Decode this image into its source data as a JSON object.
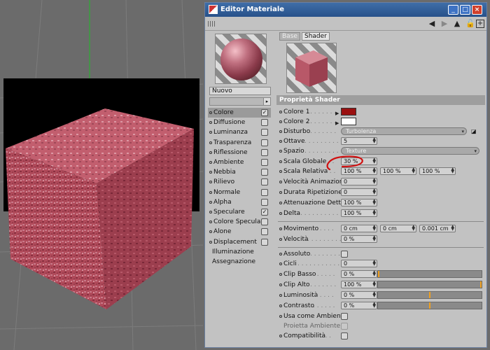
{
  "window": {
    "title": "Editor Materiale",
    "toolbar_icons": [
      "back-arrow-icon",
      "forward-arrow-icon",
      "up-arrow-icon",
      "lock-icon",
      "plus-icon"
    ]
  },
  "material": {
    "name": "Nuovo",
    "channels": [
      {
        "label": "Colore",
        "checked": true,
        "selected": true
      },
      {
        "label": "Diffusione",
        "checked": false
      },
      {
        "label": "Luminanza",
        "checked": false
      },
      {
        "label": "Trasparenza",
        "checked": false
      },
      {
        "label": "Riflessione",
        "checked": false
      },
      {
        "label": "Ambiente",
        "checked": false
      },
      {
        "label": "Nebbia",
        "checked": false
      },
      {
        "label": "Rilievo",
        "checked": false
      },
      {
        "label": "Normale",
        "checked": false
      },
      {
        "label": "Alpha",
        "checked": false
      },
      {
        "label": "Speculare",
        "checked": true
      },
      {
        "label": "Colore Speculare",
        "checked": false
      },
      {
        "label": "Alone",
        "checked": false
      },
      {
        "label": "Displacement",
        "checked": false
      }
    ],
    "extra_items": [
      "Illuminazione",
      "Assegnazione"
    ]
  },
  "tabs": [
    "Base",
    "Shader"
  ],
  "shader": {
    "section_title": "Proprietà Shader",
    "colore1": {
      "label": "Colore 1",
      "color": "#9a1010"
    },
    "colore2": {
      "label": "Colore 2",
      "color": "#ffffff"
    },
    "disturbo": {
      "label": "Disturbo",
      "value": "Turbolenza"
    },
    "ottave": {
      "label": "Ottave",
      "value": "5"
    },
    "spazio": {
      "label": "Spazio",
      "value": "Texture"
    },
    "scala_globale": {
      "label": "Scala Globale",
      "value": "30 %"
    },
    "scala_relativa": {
      "label": "Scala Relativa",
      "values": [
        "100 %",
        "100 %",
        "100 %"
      ]
    },
    "velocita_animazione": {
      "label": "Velocità Animazione",
      "value": "0"
    },
    "durata_ripetizione": {
      "label": "Durata Ripetizione",
      "value": "0"
    },
    "attenuazione_dettagli": {
      "label": "Attenuazione Dettagli",
      "value": "100 %"
    },
    "delta": {
      "label": "Delta",
      "value": "100 %"
    },
    "movimento": {
      "label": "Movimento",
      "values": [
        "0 cm",
        "0 cm",
        "0.001 cm"
      ]
    },
    "velocita": {
      "label": "Velocità",
      "value": "0 %"
    },
    "assoluto": {
      "label": "Assoluto",
      "checked": false
    },
    "cicli": {
      "label": "Cicli",
      "value": "0"
    },
    "clip_basso": {
      "label": "Clip Basso",
      "value": "0 %",
      "level": 0
    },
    "clip_alto": {
      "label": "Clip Alto",
      "value": "100 %",
      "level": 1
    },
    "luminosita": {
      "label": "Luminosità",
      "value": "0 %",
      "level": 0.5
    },
    "contrasto": {
      "label": "Contrasto",
      "value": "0 %",
      "level": 0.5
    },
    "usa_come_ambiente": {
      "label": "Usa come Ambiente",
      "checked": false
    },
    "proietta_ambiente": {
      "label": "Proietta Ambiente",
      "checked": false,
      "disabled": true
    },
    "compatibilita": {
      "label": "Compatibilità",
      "checked": false
    }
  },
  "colors": {
    "titlebar": "#27518a",
    "panel": "#c2c2c2",
    "accent_marker": "#f0a020",
    "annotation_ink": "#d01010",
    "cube_material": "#b04a5a"
  }
}
